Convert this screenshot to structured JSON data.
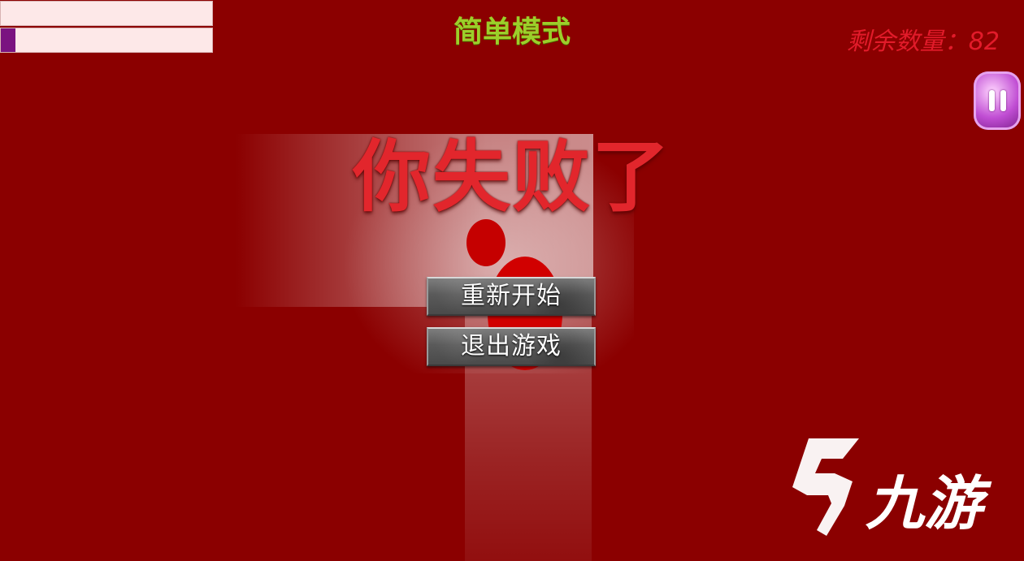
{
  "hud": {
    "mode_label": "简单模式",
    "remaining_text": "剩余数量：82",
    "progress_fraction": 0.07,
    "pause_icon": "pause-icon",
    "colors": {
      "background": "#8b0000",
      "mode_label": "#9ccf2a",
      "remaining_text": "#e21b2a",
      "pause_button": "#c04dd3"
    }
  },
  "dialog": {
    "title": "你失败了",
    "buttons": {
      "restart_label": "重新开始",
      "exit_label": "退出游戏"
    },
    "title_color": "#e2262c"
  },
  "watermark": {
    "text": "九游",
    "logo_icon": "jiuyou-logo-icon"
  }
}
